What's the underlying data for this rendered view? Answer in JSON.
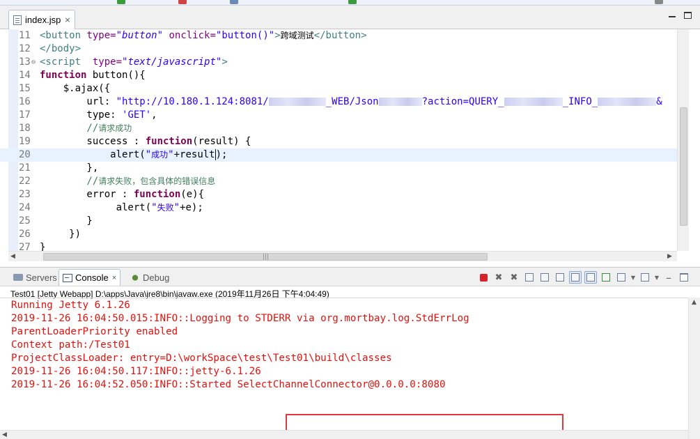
{
  "editor": {
    "tab_label": "index.jsp",
    "tab_close": "×",
    "lines": [
      {
        "n": "11",
        "segments": [
          {
            "c": "tag",
            "t": "<button "
          },
          {
            "c": "attr",
            "t": "type="
          },
          {
            "c": "stri",
            "t": "\"button\""
          },
          {
            "c": "",
            "t": " "
          },
          {
            "c": "attr",
            "t": "onclick="
          },
          {
            "c": "str",
            "t": "\"button()\""
          },
          {
            "c": "tag",
            "t": ">"
          },
          {
            "c": "cn",
            "t": "跨域测试"
          },
          {
            "c": "tag",
            "t": "</button>"
          }
        ]
      },
      {
        "n": "12",
        "segments": [
          {
            "c": "tag",
            "t": "</body>"
          }
        ]
      },
      {
        "n": "13",
        "fold": "⊖",
        "segments": [
          {
            "c": "tag",
            "t": "<script  "
          },
          {
            "c": "attr",
            "t": "type="
          },
          {
            "c": "stri",
            "t": "\"text/javascript\""
          },
          {
            "c": "tag",
            "t": ">"
          }
        ]
      },
      {
        "n": "14",
        "segments": [
          {
            "c": "kw",
            "t": "function"
          },
          {
            "c": "",
            "t": " button(){"
          }
        ]
      },
      {
        "n": "15",
        "segments": [
          {
            "c": "",
            "t": "    $.ajax({"
          }
        ]
      },
      {
        "n": "16",
        "segments": [
          {
            "c": "",
            "t": "        url: "
          },
          {
            "c": "str",
            "t": "\"http://10.180.1.124:8081/"
          },
          {
            "c": "blur",
            "w": 82
          },
          {
            "c": "str",
            "t": "_WEB/Json"
          },
          {
            "c": "blur",
            "w": 62
          },
          {
            "c": "str",
            "t": "?action=QUERY_"
          },
          {
            "c": "blur",
            "w": 84
          },
          {
            "c": "str",
            "t": "_INFO_"
          },
          {
            "c": "blur",
            "w": 84
          },
          {
            "c": "str",
            "t": "&"
          }
        ]
      },
      {
        "n": "17",
        "segments": [
          {
            "c": "",
            "t": "        type: "
          },
          {
            "c": "str",
            "t": "'GET'"
          },
          {
            "c": "",
            "t": ","
          }
        ]
      },
      {
        "n": "18",
        "segments": [
          {
            "c": "cmt",
            "t": "        //"
          },
          {
            "c": "cmt cn",
            "t": "请求成功"
          }
        ]
      },
      {
        "n": "19",
        "segments": [
          {
            "c": "",
            "t": "        success : "
          },
          {
            "c": "kw",
            "t": "function"
          },
          {
            "c": "",
            "t": "(result) {"
          }
        ]
      },
      {
        "n": "20",
        "current": true,
        "segments": [
          {
            "c": "",
            "t": "            alert("
          },
          {
            "c": "str",
            "t": "\""
          },
          {
            "c": "str cn",
            "t": "成功"
          },
          {
            "c": "str",
            "t": "\""
          },
          {
            "c": "",
            "t": "+result"
          },
          {
            "c": "caret"
          },
          {
            "c": "",
            "t": ");"
          }
        ]
      },
      {
        "n": "21",
        "segments": [
          {
            "c": "",
            "t": "        },"
          }
        ]
      },
      {
        "n": "22",
        "segments": [
          {
            "c": "cmt",
            "t": "        //"
          },
          {
            "c": "cmt cn",
            "t": "请求失败，包含具体的错误信息"
          }
        ]
      },
      {
        "n": "23",
        "segments": [
          {
            "c": "",
            "t": "        error : "
          },
          {
            "c": "kw",
            "t": "function"
          },
          {
            "c": "",
            "t": "(e){"
          }
        ]
      },
      {
        "n": "24",
        "segments": [
          {
            "c": "",
            "t": "             alert("
          },
          {
            "c": "str",
            "t": "\""
          },
          {
            "c": "str cn",
            "t": "失败"
          },
          {
            "c": "str",
            "t": "\""
          },
          {
            "c": "",
            "t": "+e);"
          }
        ]
      },
      {
        "n": "25",
        "segments": [
          {
            "c": "",
            "t": "        }"
          }
        ]
      },
      {
        "n": "26",
        "segments": [
          {
            "c": "",
            "t": "     })"
          }
        ]
      },
      {
        "n": "27",
        "segments": [
          {
            "c": "",
            "t": "}"
          }
        ]
      }
    ],
    "hscroll_grip": "|||"
  },
  "console": {
    "tabs": [
      {
        "id": "servers",
        "label": "Servers"
      },
      {
        "id": "console",
        "label": "Console",
        "close": "×"
      },
      {
        "id": "debug",
        "label": "Debug"
      }
    ],
    "launch": "Test01 [Jetty Webapp] D:\\apps\\Java\\jre8\\bin\\javaw.exe (2019年11月26日 下午4:04:49)",
    "output": [
      "Running Jetty 6.1.26",
      "2019-11-26 16:04:50.015:INFO::Logging to STDERR via org.mortbay.log.StdErrLog",
      "ParentLoaderPriority enabled",
      "Context path:/Test01",
      "ProjectClassLoader: entry=D:\\workSpace\\test\\Test01\\build\\classes",
      "2019-11-26 16:04:50.117:INFO::jetty-6.1.26",
      "2019-11-26 16:04:52.050:INFO::Started SelectChannelConnector@0.0.0.0:8080"
    ],
    "toolbar_icons": [
      "terminate-icon",
      "remove-launch-icon",
      "remove-all-icon",
      "clear-console-icon",
      "scroll-lock-icon",
      "word-wrap-icon",
      "show-on-stdout-icon",
      "show-on-stderr-icon",
      "pin-console-icon",
      "display-console-icon",
      "open-console-icon",
      "minimize-icon",
      "maximize-icon"
    ],
    "output_color": "#e3110d",
    "highlight_color": "#e0383c"
  }
}
